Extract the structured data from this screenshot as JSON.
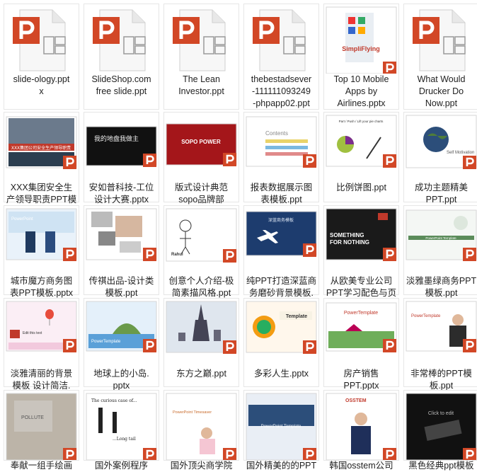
{
  "colors": {
    "ppt_orange": "#d24726",
    "tile_border": "#e6e6e6",
    "label_text": "#222222"
  },
  "files": [
    {
      "label": "slide-ology.ppt\nx",
      "thumb": "generic"
    },
    {
      "label": "SlideShop.com\nfree slide.ppt",
      "thumb": "generic"
    },
    {
      "label": "The Lean\nInvestor.ppt",
      "thumb": "generic"
    },
    {
      "label": "thebestadsever\n-111111093249\n-phpapp02.ppt",
      "thumb": "generic"
    },
    {
      "label": "Top 10 Mobile\nApps by\nAirlines.pptx",
      "thumb": "airlines",
      "slide_text": "SimpliFlying"
    },
    {
      "label": "What Would\nDrucker Do\nNow.ppt",
      "thumb": "generic"
    },
    {
      "label": "XXX集团安全生\n产领导职责PPT模\n板.pptx",
      "thumb": "safety",
      "slide_text": "XXX集团公司安全生产领导职责"
    },
    {
      "label": "安如普科技-工位\n设计大赛.pptx",
      "thumb": "dark",
      "slide_text": "我的地盘我做主"
    },
    {
      "label": "版式设计典范\nsopo品牌部\nPPT.pptx",
      "thumb": "red",
      "slide_text": "SOPO POWER"
    },
    {
      "label": "报表数据展示图\n表模板.ppt",
      "thumb": "report",
      "slide_text": "Contents"
    },
    {
      "label": "比例饼图.ppt",
      "thumb": "pie",
      "slide_text": "Part / Push / Lift your pie charts"
    },
    {
      "label": "成功主题精美\nPPT.ppt",
      "thumb": "globe",
      "slide_text": "Self Motivation"
    },
    {
      "label": "城市魔方商务图\n表PPT模板.pptx",
      "thumb": "handshake",
      "slide_text": "PowerPoint"
    },
    {
      "label": "传祺出品-设计类\n模板.ppt",
      "thumb": "photos"
    },
    {
      "label": "创意个人介绍-极\n简素描风格.ppt",
      "thumb": "sketch",
      "slide_text": "Rahul"
    },
    {
      "label": "纯PPT打造深蓝商\n务磨砂背景模板.\npptx",
      "thumb": "plane",
      "slide_text": "深蓝商务模板"
    },
    {
      "label": "从欧美专业公司\nPPT学习配色与页\n面排版.pptx",
      "thumb": "nothing",
      "slide_text": "SOMETHING FOR NOTHING"
    },
    {
      "label": "淡雅墨绿商务PPT\n模板.ppt",
      "thumb": "green",
      "slide_text": "PowerPoint Template"
    },
    {
      "label": "淡雅清丽的背景\n模板 设计简洁.\nppt",
      "thumb": "balloon",
      "slide_text": "Edit this text"
    },
    {
      "label": "地球上的小岛.\npptx",
      "thumb": "island",
      "slide_text": "PowerTemplate"
    },
    {
      "label": "东方之巅.ppt",
      "thumb": "tower"
    },
    {
      "label": "多彩人生.pptx",
      "thumb": "colorful",
      "slide_text": "Template"
    },
    {
      "label": "房产销售\nPPT.pptx",
      "thumb": "house",
      "slide_text": "PowerTemplate"
    },
    {
      "label": "非常棒的PPT模\n板.ppt",
      "thumb": "man",
      "slide_text": "PowerTemplate"
    },
    {
      "label": "奉献一组手绘画",
      "thumb": "wood",
      "slide_text": "POLLUTE"
    },
    {
      "label": "国外案例程序",
      "thumb": "curious",
      "slide_text": "The curious case of..."
    },
    {
      "label": "国外顶尖商学院",
      "thumb": "business",
      "slide_text": "PowerPoint Timesaver"
    },
    {
      "label": "国外精美的的PPT",
      "thumb": "template",
      "slide_text": "PowerPoint Template"
    },
    {
      "label": "韩国osstem公司",
      "thumb": "osstem",
      "slide_text": "OSSTEM"
    },
    {
      "label": "黑色经典ppt模板",
      "thumb": "black",
      "slide_text": "Click to edit"
    }
  ]
}
